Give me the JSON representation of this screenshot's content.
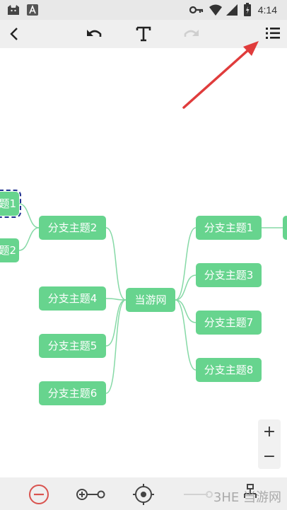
{
  "status_bar": {
    "time": "4:14",
    "icons": [
      "cat-app-icon",
      "a-app-icon",
      "key-icon",
      "wifi-icon",
      "signal-icon",
      "battery-icon"
    ]
  },
  "toolbar": {
    "icons": [
      "back-icon",
      "undo-icon",
      "text-icon",
      "redo-icon",
      "outline-list-icon"
    ]
  },
  "mindmap": {
    "center": "当游网",
    "right_topics": [
      "分支主题1",
      "分支主题3",
      "分支主题7",
      "分支主题8"
    ],
    "left_topics": [
      "分支主题2",
      "分支主题4",
      "分支主题5",
      "分支主题6"
    ],
    "far_left_topics": [
      "题1",
      "题2"
    ]
  },
  "zoom": {
    "plus": "+",
    "minus": "−"
  },
  "bottom_bar": {
    "icons": [
      "remove-node-icon",
      "add-connection-icon",
      "locate-center-icon",
      "link-icon",
      "structure-icon"
    ]
  },
  "watermark": "3HE 当游网",
  "colors": {
    "node": "#67d48e",
    "connector": "#86d9a6",
    "arrow": "#e03c3c",
    "remove": "#d9534f"
  }
}
